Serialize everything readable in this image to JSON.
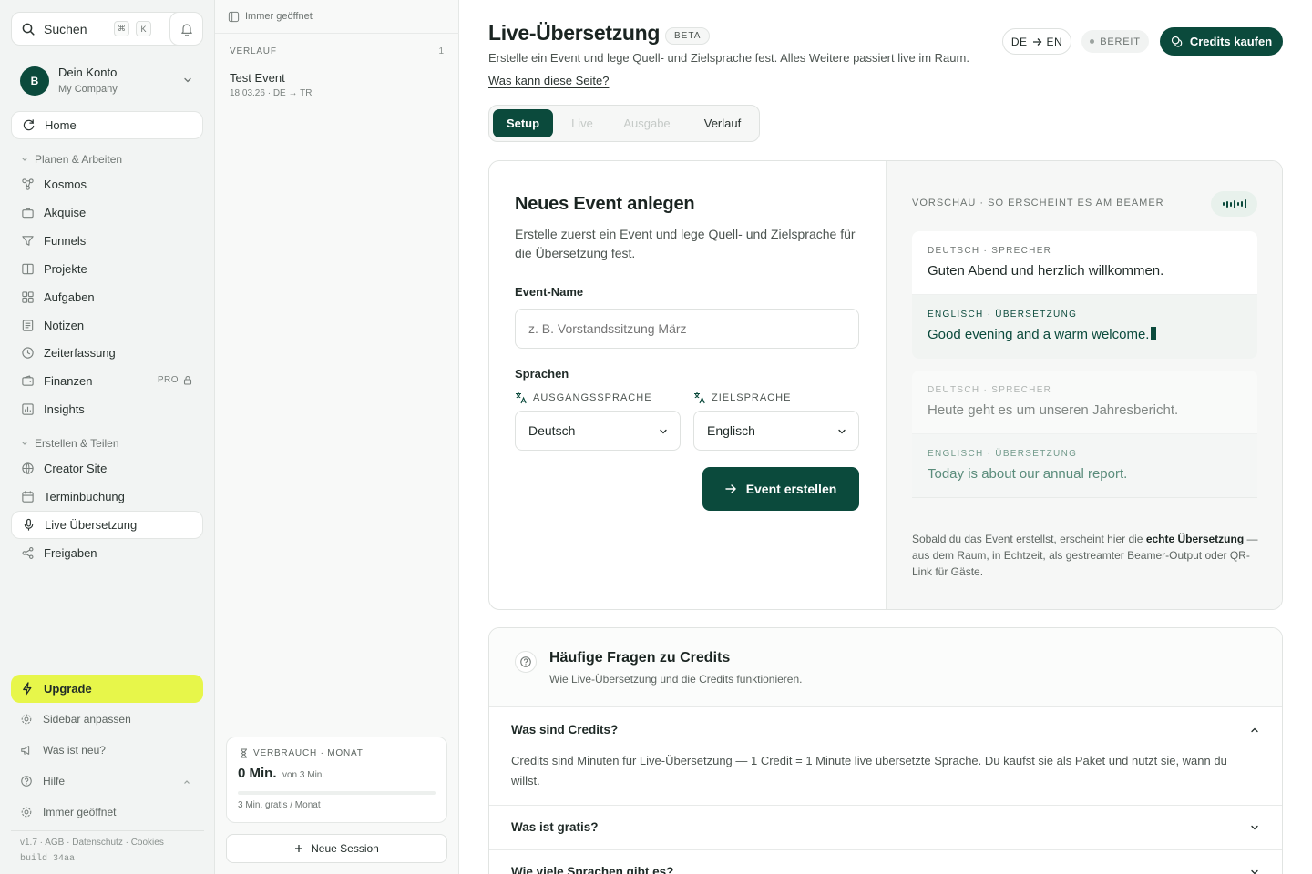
{
  "sidebar": {
    "search": {
      "label": "Suchen",
      "kbd1": "⌘",
      "kbd2": "K"
    },
    "account": {
      "initial": "B",
      "name": "Dein Konto",
      "company": "My Company"
    },
    "home": "Home",
    "section1": "Planen & Arbeiten",
    "items1": [
      "Kosmos",
      "Akquise",
      "Funnels",
      "Projekte",
      "Aufgaben",
      "Notizen",
      "Zeiterfassung",
      "Finanzen",
      "Insights"
    ],
    "pro_badge": "PRO",
    "section2": "Erstellen & Teilen",
    "items2": [
      "Creator Site",
      "Terminbuchung",
      "Live Übersetzung",
      "Freigaben"
    ],
    "upgrade": "Upgrade",
    "bottom": [
      "Sidebar anpassen",
      "Was ist neu?",
      "Hilfe",
      "Immer geöffnet"
    ],
    "footer_links": "v1.7 · AGB · Datenschutz · Cookies",
    "build": "build 34aa"
  },
  "history": {
    "pinned": "Immer geöffnet",
    "label": "VERLAUF",
    "count": "1",
    "items": [
      {
        "title": "Test Event",
        "meta": "18.03.26 · DE → TR"
      }
    ],
    "usage": {
      "label": "VERBRAUCH · MONAT",
      "value": "0 Min.",
      "of": "von 3 Min.",
      "fraction": 0,
      "note": "3 Min. gratis / Monat"
    },
    "new_session": "Neue Session"
  },
  "header": {
    "title": "Live-Übersetzung",
    "badge": "BETA",
    "subtitle": "Erstelle ein Event und lege Quell- und Zielsprache fest. Alles Weitere passiert live im Raum.",
    "help_link": "Was kann diese Seite?",
    "lang_from": "DE",
    "lang_to": "EN",
    "status": "BEREIT",
    "buy": "Credits kaufen"
  },
  "tabs": [
    "Setup",
    "Live",
    "Ausgabe",
    "Verlauf"
  ],
  "form": {
    "title": "Neues Event anlegen",
    "desc": "Erstelle zuerst ein Event und lege Quell- und Zielsprache für die Übersetzung fest.",
    "name_label": "Event-Name",
    "name_placeholder": "z. B. Vorstandssitzung März",
    "lang_label": "Sprachen",
    "source_label": "AUSGANGSSPRACHE",
    "target_label": "ZIELSPRACHE",
    "source_value": "Deutsch",
    "target_value": "Englisch",
    "submit": "Event erstellen"
  },
  "preview": {
    "label": "VORSCHAU · SO ERSCHEINT ES AM BEAMER",
    "rows": [
      {
        "key": "DEUTSCH · SPRECHER",
        "text": "Guten Abend und herzlich willkommen."
      },
      {
        "key": "ENGLISCH · ÜBERSETZUNG",
        "text": "Good evening and a warm welcome."
      },
      {
        "key": "DEUTSCH · SPRECHER",
        "text": "Heute geht es um unseren Jahresbericht."
      },
      {
        "key": "ENGLISCH · ÜBERSETZUNG",
        "text": "Today is about our annual report."
      }
    ],
    "note_pre": "Sobald du das Event erstellst, erscheint hier die ",
    "note_bold": "echte Übersetzung",
    "note_post": " — aus dem Raum, in Echtzeit, als gestreamter Beamer-Output oder QR-Link für Gäste."
  },
  "faq": {
    "title": "Häufige Fragen zu Credits",
    "subtitle": "Wie Live-Übersetzung und die Credits funktionieren.",
    "items": [
      {
        "q": "Was sind Credits?",
        "a": "Credits sind Minuten für Live-Übersetzung — 1 Credit = 1 Minute live übersetzte Sprache. Du kaufst sie als Paket und nutzt sie, wann du willst."
      },
      {
        "q": "Was ist gratis?"
      },
      {
        "q": "Wie viele Sprachen gibt es?"
      }
    ]
  }
}
